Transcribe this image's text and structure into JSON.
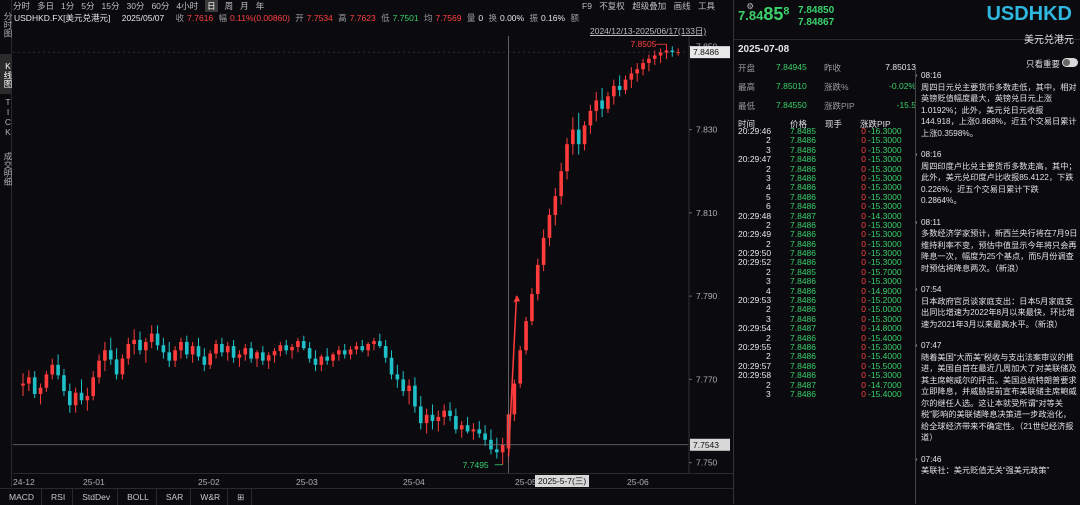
{
  "left_tabs": [
    "分时图",
    "K线图",
    "TICK",
    "成交明细"
  ],
  "periods": [
    "分时",
    "多日",
    "1分",
    "5分",
    "15分",
    "30分",
    "60分",
    "4小时",
    "日",
    "周",
    "月",
    "年"
  ],
  "active_period": "日",
  "toolbar_right": [
    "F9",
    "不复权",
    "超级叠加",
    "画线",
    "工具",
    "⚙"
  ],
  "info": {
    "symbol": "USDHKD.FX[美元兑港元]",
    "date": "2025/05/07",
    "close_label": "收",
    "close": "7.7616",
    "change_label": "幅",
    "change": "0.11%(0.00860)",
    "open_label": "开",
    "open": "7.7534",
    "high_label": "高",
    "high": "7.7623",
    "low_label": "低",
    "low": "7.7501",
    "avg_label": "均",
    "avg": "7.7569",
    "vol_label": "量",
    "vol": "0",
    "turnover_label": "换",
    "turnover": "0.00%",
    "amp_label": "振",
    "amp": "0.16%",
    "amount_label": "额",
    "amount": ""
  },
  "range_label": "2024/12/13-2025/06/17(133日)",
  "y_axis": {
    "ticks": [
      "7.850",
      "7.830",
      "7.810",
      "7.790",
      "7.770",
      "7.750"
    ],
    "current_price_tag": "7.8486",
    "crosshair_price_tag": "7.7543",
    "max_label": "7.8505",
    "min_label": "7.7495"
  },
  "x_axis": {
    "ticks": [
      "24-12",
      "25-01",
      "25-02",
      "25-03",
      "25-04",
      "25-05",
      "25-06"
    ],
    "crosshair_label": "2025-5-7(三)"
  },
  "indicator_tabs": [
    "MACD",
    "RSI",
    "StdDev",
    "BOLL",
    "SAR",
    "W&R",
    "⊞"
  ],
  "chart_data": {
    "type": "candlestick",
    "ylim": [
      7.748,
      7.852
    ],
    "colors": {
      "up": "#ff3b3b",
      "down": "#20c0c8"
    },
    "series": [
      {
        "name": "",
        "ohlc": [
          [
            7.7685,
            7.7715,
            7.766,
            7.769
          ],
          [
            7.769,
            7.7722,
            7.7672,
            7.7705
          ],
          [
            7.7705,
            7.772,
            7.7655,
            7.7665
          ],
          [
            7.7665,
            7.769,
            7.764,
            7.768
          ],
          [
            7.768,
            7.772,
            7.767,
            7.7712
          ],
          [
            7.7712,
            7.775,
            7.77,
            7.7735
          ],
          [
            7.7735,
            7.776,
            7.77,
            7.771
          ],
          [
            7.771,
            7.7725,
            7.766,
            7.7672
          ],
          [
            7.7672,
            7.769,
            7.762,
            7.7638
          ],
          [
            7.7638,
            7.768,
            7.762,
            7.7668
          ],
          [
            7.7668,
            7.77,
            7.764,
            7.765
          ],
          [
            7.765,
            7.768,
            7.7625,
            7.766
          ],
          [
            7.766,
            7.772,
            7.765,
            7.7705
          ],
          [
            7.7705,
            7.776,
            7.769,
            7.7745
          ],
          [
            7.7745,
            7.779,
            7.772,
            7.777
          ],
          [
            7.777,
            7.78,
            7.7735,
            7.7748
          ],
          [
            7.7748,
            7.7775,
            7.77,
            7.7712
          ],
          [
            7.7712,
            7.776,
            7.77,
            7.775
          ],
          [
            7.775,
            7.78,
            7.7735,
            7.7785
          ],
          [
            7.7785,
            7.782,
            7.776,
            7.7795
          ],
          [
            7.7795,
            7.7815,
            7.776,
            7.777
          ],
          [
            7.777,
            7.78,
            7.774,
            7.779
          ],
          [
            7.779,
            7.783,
            7.7775,
            7.781
          ],
          [
            7.781,
            7.783,
            7.777,
            7.7782
          ],
          [
            7.7782,
            7.78,
            7.775,
            7.7765
          ],
          [
            7.7765,
            7.779,
            7.773,
            7.7745
          ],
          [
            7.7745,
            7.778,
            7.773,
            7.777
          ],
          [
            7.777,
            7.78,
            7.775,
            7.779
          ],
          [
            7.779,
            7.7805,
            7.775,
            7.776
          ],
          [
            7.776,
            7.779,
            7.774,
            7.778
          ],
          [
            7.778,
            7.78,
            7.7745,
            7.7755
          ],
          [
            7.7755,
            7.7775,
            7.772,
            7.7735
          ],
          [
            7.7735,
            7.777,
            7.7725,
            7.7762
          ],
          [
            7.7762,
            7.7795,
            7.775,
            7.7785
          ],
          [
            7.7785,
            7.78,
            7.7755,
            7.7765
          ],
          [
            7.7765,
            7.779,
            7.7745,
            7.778
          ],
          [
            7.778,
            7.7795,
            7.774,
            7.7752
          ],
          [
            7.7752,
            7.777,
            7.773,
            7.776
          ],
          [
            7.776,
            7.7785,
            7.7745,
            7.7775
          ],
          [
            7.7775,
            7.779,
            7.774,
            7.775
          ],
          [
            7.775,
            7.777,
            7.773,
            7.7765
          ],
          [
            7.7765,
            7.778,
            7.7735,
            7.7745
          ],
          [
            7.7745,
            7.7765,
            7.7725,
            7.7758
          ],
          [
            7.7758,
            7.7775,
            7.774,
            7.7768
          ],
          [
            7.7768,
            7.779,
            7.7755,
            7.7782
          ],
          [
            7.7782,
            7.7795,
            7.776,
            7.777
          ],
          [
            7.777,
            7.7785,
            7.775,
            7.7778
          ],
          [
            7.7778,
            7.78,
            7.7765,
            7.7792
          ],
          [
            7.7792,
            7.7805,
            7.777,
            7.7775
          ],
          [
            7.7775,
            7.779,
            7.774,
            7.775
          ],
          [
            7.775,
            7.777,
            7.772,
            7.7735
          ],
          [
            7.7735,
            7.776,
            7.772,
            7.7755
          ],
          [
            7.7755,
            7.7775,
            7.7735,
            7.7745
          ],
          [
            7.7745,
            7.7765,
            7.773,
            7.776
          ],
          [
            7.776,
            7.778,
            7.7745,
            7.777
          ],
          [
            7.777,
            7.7785,
            7.775,
            7.776
          ],
          [
            7.776,
            7.778,
            7.7748,
            7.7772
          ],
          [
            7.7772,
            7.779,
            7.776,
            7.778
          ],
          [
            7.778,
            7.7795,
            7.7765,
            7.777
          ],
          [
            7.777,
            7.779,
            7.7755,
            7.7785
          ],
          [
            7.7785,
            7.78,
            7.777,
            7.7792
          ],
          [
            7.7792,
            7.781,
            7.7775,
            7.778
          ],
          [
            7.778,
            7.7795,
            7.774,
            7.7752
          ],
          [
            7.7752,
            7.777,
            7.77,
            7.7712
          ],
          [
            7.7712,
            7.7735,
            7.768,
            7.77
          ],
          [
            7.77,
            7.772,
            7.766,
            7.7672
          ],
          [
            7.7672,
            7.77,
            7.764,
            7.7685
          ],
          [
            7.7685,
            7.7705,
            7.762,
            7.7635
          ],
          [
            7.7635,
            7.766,
            7.758,
            7.7595
          ],
          [
            7.7595,
            7.763,
            7.757,
            7.7615
          ],
          [
            7.7615,
            7.764,
            7.758,
            7.76
          ],
          [
            7.76,
            7.7625,
            7.7575,
            7.761
          ],
          [
            7.761,
            7.764,
            7.759,
            7.7625
          ],
          [
            7.7625,
            7.7645,
            7.76,
            7.7612
          ],
          [
            7.7612,
            7.763,
            7.757,
            7.758
          ],
          [
            7.758,
            7.76,
            7.756,
            7.759
          ],
          [
            7.759,
            7.761,
            7.757,
            7.7575
          ],
          [
            7.7575,
            7.7595,
            7.7555,
            7.758
          ],
          [
            7.758,
            7.76,
            7.756,
            7.757
          ],
          [
            7.757,
            7.759,
            7.754,
            7.7555
          ],
          [
            7.7555,
            7.758,
            7.752,
            7.7532
          ],
          [
            7.7532,
            7.756,
            7.751,
            7.7525
          ],
          [
            7.7525,
            7.756,
            7.7495,
            7.7543
          ],
          [
            7.7534,
            7.7623,
            7.7501,
            7.7616
          ],
          [
            7.7616,
            7.77,
            7.76,
            7.769
          ],
          [
            7.769,
            7.778,
            7.768,
            7.777
          ],
          [
            7.777,
            7.785,
            7.776,
            7.784
          ],
          [
            7.784,
            7.792,
            7.783,
            7.7905
          ],
          [
            7.7905,
            7.799,
            7.789,
            7.7975
          ],
          [
            7.7975,
            7.806,
            7.796,
            7.804
          ],
          [
            7.804,
            7.811,
            7.802,
            7.8095
          ],
          [
            7.8095,
            7.816,
            7.807,
            7.814
          ],
          [
            7.814,
            7.822,
            7.812,
            7.82
          ],
          [
            7.82,
            7.828,
            7.818,
            7.8265
          ],
          [
            7.8265,
            7.833,
            7.824,
            7.83
          ],
          [
            7.83,
            7.834,
            7.824,
            7.8265
          ],
          [
            7.8265,
            7.832,
            7.825,
            7.831
          ],
          [
            7.831,
            7.836,
            7.829,
            7.8345
          ],
          [
            7.8345,
            7.839,
            7.832,
            7.837
          ],
          [
            7.837,
            7.84,
            7.833,
            7.835
          ],
          [
            7.835,
            7.839,
            7.834,
            7.838
          ],
          [
            7.838,
            7.842,
            7.836,
            7.8405
          ],
          [
            7.8405,
            7.843,
            7.838,
            7.8395
          ],
          [
            7.8395,
            7.843,
            7.8385,
            7.842
          ],
          [
            7.842,
            7.845,
            7.84,
            7.8435
          ],
          [
            7.8435,
            7.846,
            7.8415,
            7.8445
          ],
          [
            7.8445,
            7.847,
            7.843,
            7.846
          ],
          [
            7.846,
            7.848,
            7.844,
            7.847
          ],
          [
            7.847,
            7.849,
            7.8455,
            7.8478
          ],
          [
            7.8478,
            7.8495,
            7.846,
            7.8485
          ],
          [
            7.8485,
            7.8505,
            7.847,
            7.849
          ],
          [
            7.849,
            7.85,
            7.8475,
            7.8486
          ],
          [
            7.8486,
            7.8495,
            7.8478,
            7.8486
          ]
        ]
      }
    ]
  },
  "quote": {
    "big_price": "7.84",
    "big_pips": "85",
    "big_super": "8",
    "bid": "7.84850",
    "ask": "7.84867",
    "symbol": "USDHKD",
    "name": "美元兑港元",
    "date": "2025-07-08",
    "important_label": "只看重要",
    "important_on": false
  },
  "stats": [
    {
      "l1": "开盘",
      "v1": "7.84945",
      "l2": "昨收",
      "v2": "7.85013"
    },
    {
      "l1": "最高",
      "v1": "7.85010",
      "l2": "涨跌%",
      "v2": "-0.02%"
    },
    {
      "l1": "最低",
      "v1": "7.84550",
      "l2": "涨跌PIP",
      "v2": "-15.5"
    }
  ],
  "ticks_header": {
    "time": "时间",
    "price": "价格",
    "vol": "现手",
    "pip": "涨跌PIP"
  },
  "ticks": [
    {
      "t": "20:29:46",
      "p": "7.8485",
      "v": "0",
      "d": "-16.3000"
    },
    {
      "t": "2",
      "p": "7.8486",
      "v": "0",
      "d": "-15.3000"
    },
    {
      "t": "3",
      "p": "7.8486",
      "v": "0",
      "d": "-15.3000"
    },
    {
      "t": "20:29:47",
      "p": "7.8486",
      "v": "0",
      "d": "-15.3000"
    },
    {
      "t": "2",
      "p": "7.8486",
      "v": "0",
      "d": "-15.3000"
    },
    {
      "t": "3",
      "p": "7.8486",
      "v": "0",
      "d": "-15.3000"
    },
    {
      "t": "4",
      "p": "7.8486",
      "v": "0",
      "d": "-15.3000"
    },
    {
      "t": "5",
      "p": "7.8486",
      "v": "0",
      "d": "-15.3000"
    },
    {
      "t": "6",
      "p": "7.8486",
      "v": "0",
      "d": "-15.3000"
    },
    {
      "t": "20:29:48",
      "p": "7.8487",
      "v": "0",
      "d": "-14.3000"
    },
    {
      "t": "2",
      "p": "7.8486",
      "v": "0",
      "d": "-15.3000"
    },
    {
      "t": "20:29:49",
      "p": "7.8486",
      "v": "0",
      "d": "-15.3000"
    },
    {
      "t": "2",
      "p": "7.8486",
      "v": "0",
      "d": "-15.3000"
    },
    {
      "t": "20:29:50",
      "p": "7.8486",
      "v": "0",
      "d": "-15.3000"
    },
    {
      "t": "20:29:52",
      "p": "7.8486",
      "v": "0",
      "d": "-15.3000"
    },
    {
      "t": "2",
      "p": "7.8485",
      "v": "0",
      "d": "-15.7000"
    },
    {
      "t": "3",
      "p": "7.8486",
      "v": "0",
      "d": "-15.3000"
    },
    {
      "t": "4",
      "p": "7.8486",
      "v": "0",
      "d": "-14.9000"
    },
    {
      "t": "20:29:53",
      "p": "7.8486",
      "v": "0",
      "d": "-15.2000"
    },
    {
      "t": "2",
      "p": "7.8486",
      "v": "0",
      "d": "-15.0000"
    },
    {
      "t": "3",
      "p": "7.8486",
      "v": "0",
      "d": "-15.3000"
    },
    {
      "t": "20:29:54",
      "p": "7.8487",
      "v": "0",
      "d": "-14.8000"
    },
    {
      "t": "2",
      "p": "7.8486",
      "v": "0",
      "d": "-15.4000"
    },
    {
      "t": "20:29:55",
      "p": "7.8486",
      "v": "0",
      "d": "-15.3000"
    },
    {
      "t": "2",
      "p": "7.8486",
      "v": "0",
      "d": "-15.4000"
    },
    {
      "t": "20:29:57",
      "p": "7.8486",
      "v": "0",
      "d": "-15.5000"
    },
    {
      "t": "20:29:58",
      "p": "7.8486",
      "v": "0",
      "d": "-15.3000"
    },
    {
      "t": "2",
      "p": "7.8487",
      "v": "0",
      "d": "-14.7000"
    },
    {
      "t": "3",
      "p": "7.8486",
      "v": "0",
      "d": "-15.4000"
    }
  ],
  "news": [
    {
      "time": "08:16",
      "text": "周四日元兑主要货币多数走低，其中，相对英镑贬值幅度最大，英镑兑日元上涨1.0192%；此外，美元兑日元收报144.918，上涨0.868%，近五个交易日累计上涨0.3598%。"
    },
    {
      "time": "08:16",
      "text": "周四印度卢比兑主要货币多数走高，其中；此外，美元兑印度卢比收报85.4122，下跌0.226%，近五个交易日累计下跌0.2864%。"
    },
    {
      "time": "08:11",
      "text": "多数经济学家预计，新西兰央行将在7月9日维持利率不变，预估中值显示今年将只会再降息一次，幅度为25个基点，而5月份调查时预估将降息两次。（新浪）"
    },
    {
      "time": "07:54",
      "text": "日本政府官员谈家庭支出：日本5月家庭支出同比增速为2022年8月以来最快，环比增速为2021年3月以来最高水平。（新浪）"
    },
    {
      "time": "07:47",
      "text": "随着美国“大而美”税收与支出法案审议的推进，美国自首在最近几周加大了对美联储及其主席鲍威尔的抨击。美国总统特朗普要求立即降息，并威胁提前宣布美联储主席鲍威尔的继任人选。这让本就受所谓“对等关税”影响的美联储降息决策进一步政治化，给全球经济带来不确定性。（21世纪经济报道）"
    },
    {
      "time": "07:46",
      "text": "美联社：美元贬值无关“强美元政策”"
    }
  ]
}
